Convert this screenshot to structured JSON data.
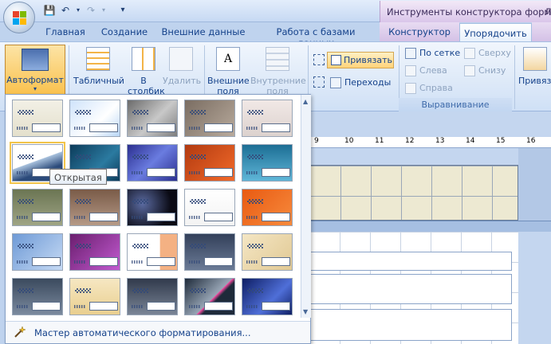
{
  "titlebar": {
    "context_title": "Инструменты конструктора форм",
    "context_title_cut": "Л"
  },
  "tabs": [
    {
      "label": "Главная"
    },
    {
      "label": "Создание"
    },
    {
      "label": "Внешние данные"
    },
    {
      "label": "Работа с базами данных"
    },
    {
      "label": "Конструктор"
    },
    {
      "label": "Упорядочить"
    }
  ],
  "ribbon": {
    "autoformat_label": "Автоформат",
    "tabular_label": "Табличный",
    "columnar_label_1": "В",
    "columnar_label_2": "столбик",
    "remove_label": "Удалить",
    "outer_margins_1": "Внешние",
    "outer_margins_2": "поля",
    "inner_margins_1": "Внутренние",
    "inner_margins_2": "поля",
    "snap_label": "Привязать",
    "transitions_label": "Переходы",
    "to_grid_label": "По сетке",
    "left_label": "Слева",
    "right_label": "Справа",
    "top_label": "Сверху",
    "bottom_label": "Снизу",
    "align_group_label": "Выравнивание",
    "bring_label": "Привяз"
  },
  "ruler_ticks": [
    "9",
    "10",
    "11",
    "12",
    "13",
    "14",
    "15",
    "16"
  ],
  "gallery": {
    "tooltip": "Открытая",
    "footer_label": "Мастер автоматического форматирования..."
  },
  "colors": {
    "accent": "#f9c14d",
    "ribbon_text": "#15428b",
    "context_tab": "#d4c1e6"
  }
}
